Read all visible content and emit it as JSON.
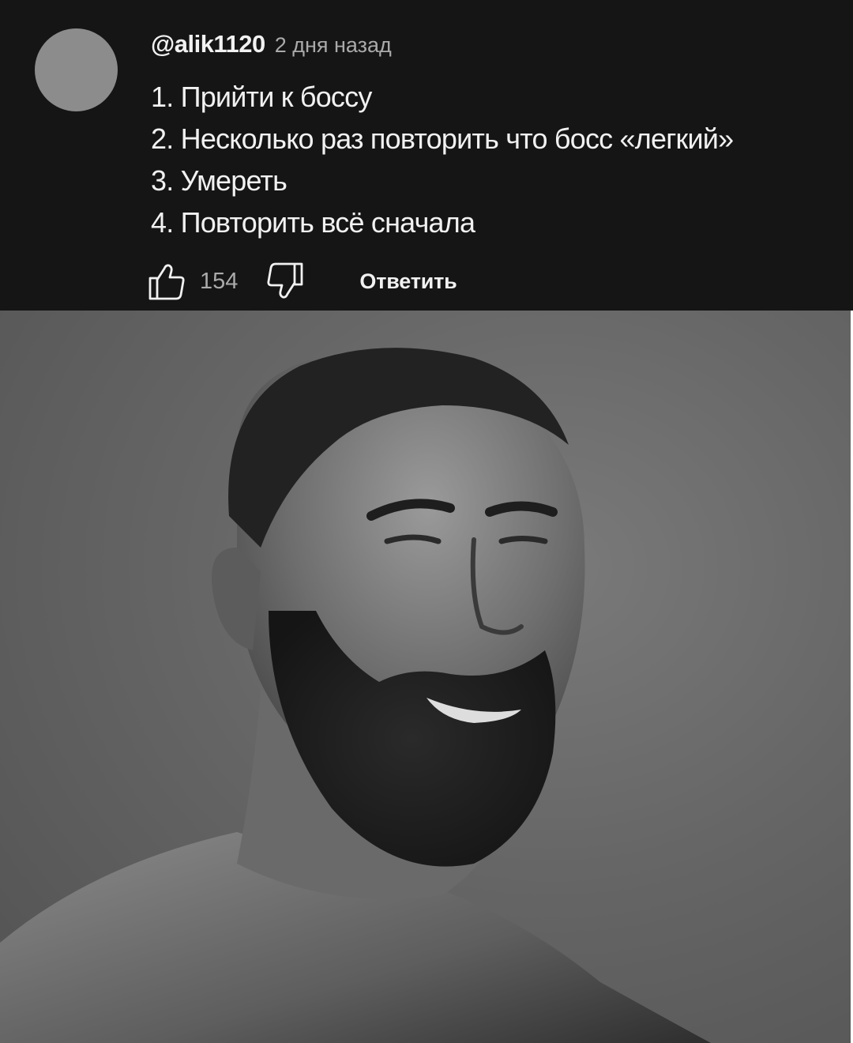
{
  "comment": {
    "username": "@alik1120",
    "timestamp": "2 дня назад",
    "lines": [
      "1. Прийти к боссу",
      "2. Несколько раз повторить что босс «легкий»",
      "3. Умереть",
      "4. Повторить всё сначала"
    ],
    "like_count": "154",
    "reply_label": "Ответить"
  },
  "icons": {
    "like": "thumbs-up-icon",
    "dislike": "thumbs-down-icon"
  },
  "colors": {
    "background": "#151515",
    "primary_text": "#f1f1f1",
    "secondary_text": "#aaaaaa",
    "avatar": "#8c8c8c"
  }
}
